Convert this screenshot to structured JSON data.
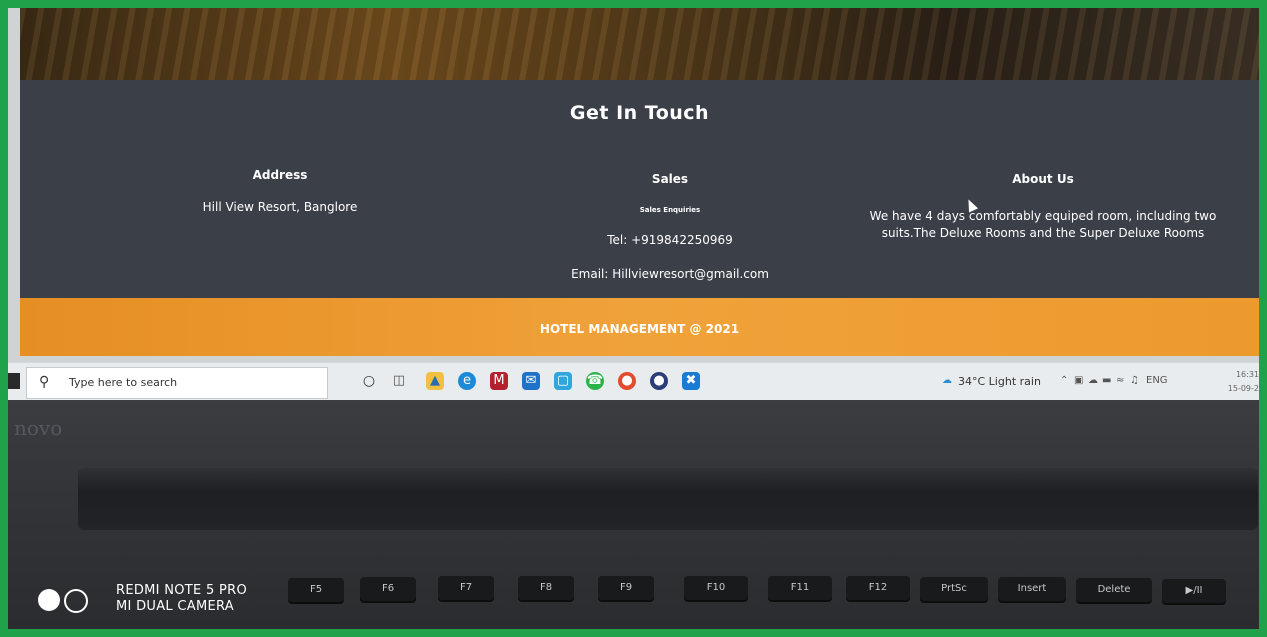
{
  "contact": {
    "title": "Get In Touch",
    "address": {
      "heading": "Address",
      "text": "Hill View Resort, Banglore"
    },
    "sales": {
      "heading": "Sales",
      "subheading": "Sales Enquiries",
      "tel": "Tel: +919842250969",
      "email": "Email: Hillviewresort@gmail.com"
    },
    "about": {
      "heading": "About Us",
      "text": "We have 4 days comfortably equiped room, including two suits.The Deluxe Rooms and the Super Deluxe Rooms"
    }
  },
  "footer": {
    "text": "HOTEL MANAGEMENT @ 2021"
  },
  "taskbar": {
    "search_placeholder": "Type here to search",
    "weather": "34°C  Light rain",
    "language": "ENG",
    "time": "16:31",
    "date": "15-09-2"
  },
  "laptop": {
    "brand": "novo"
  },
  "keyboard": {
    "keys": [
      "F5",
      "F6",
      "F7",
      "F8",
      "F9",
      "F10",
      "F11",
      "F12",
      "PrtSc",
      "Insert",
      "Delete",
      "▶/II"
    ]
  },
  "watermark": {
    "line1": "REDMI NOTE 5 PRO",
    "line2": "MI DUAL CAMERA"
  },
  "colors": {
    "contact_bg": "#3a3f48",
    "footer_orange": "#ec9a2e",
    "frame_green": "#1fa24a",
    "taskbar_bg": "#e9ecee"
  }
}
